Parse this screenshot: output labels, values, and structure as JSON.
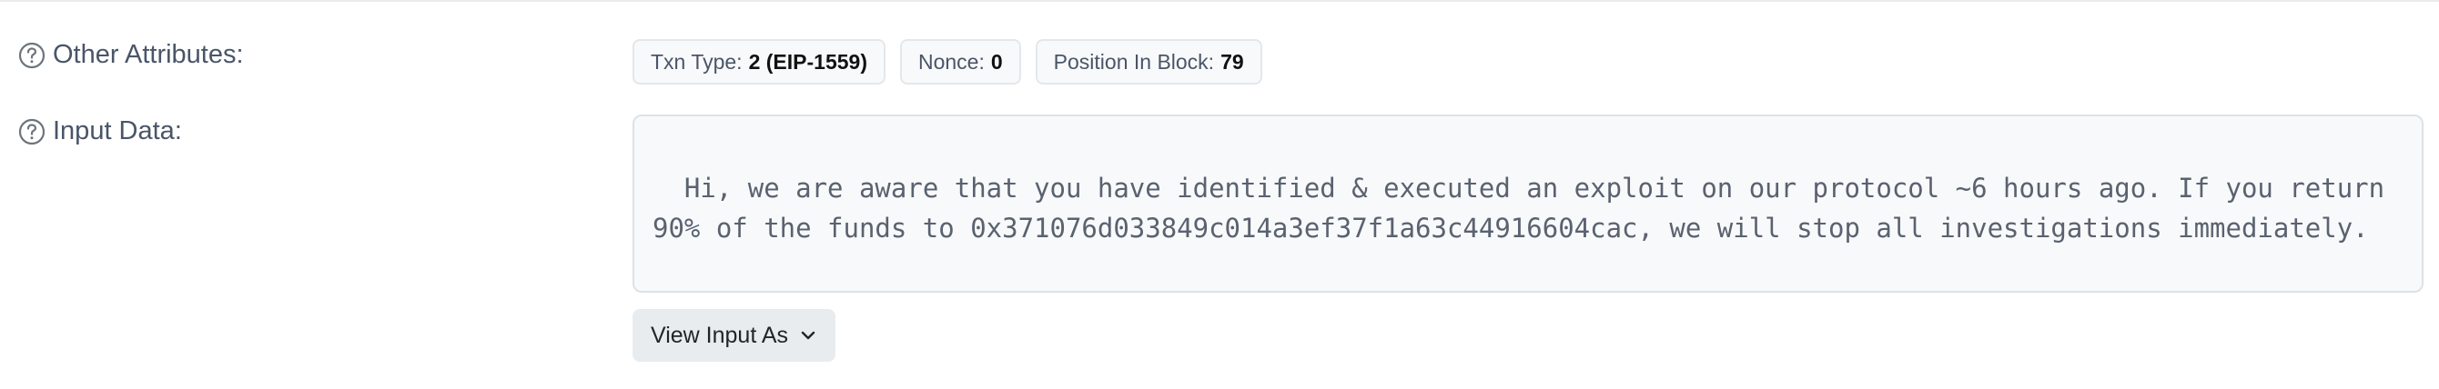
{
  "other_attributes": {
    "label": "Other Attributes:",
    "badges": [
      {
        "key": "Txn Type:",
        "value": "2 (EIP-1559)"
      },
      {
        "key": "Nonce:",
        "value": "0"
      },
      {
        "key": "Position In Block:",
        "value": "79"
      }
    ]
  },
  "input_data": {
    "label": "Input Data:",
    "text": "Hi, we are aware that you have identified & executed an exploit on our protocol ~6 hours ago. If you return 90% of the funds to 0x371076d033849c014a3ef37f1a63c44916604cac, we will stop all investigations immediately."
  },
  "view_input_button": {
    "label": "View Input As",
    "icon": "chevron-down-icon"
  },
  "icons": {
    "help": "question-circle-icon"
  },
  "colors": {
    "label_text": "#4a5568",
    "badge_bg": "#f8f9fa",
    "input_bg": "#f8f9fa",
    "button_bg": "#e9ecef"
  }
}
